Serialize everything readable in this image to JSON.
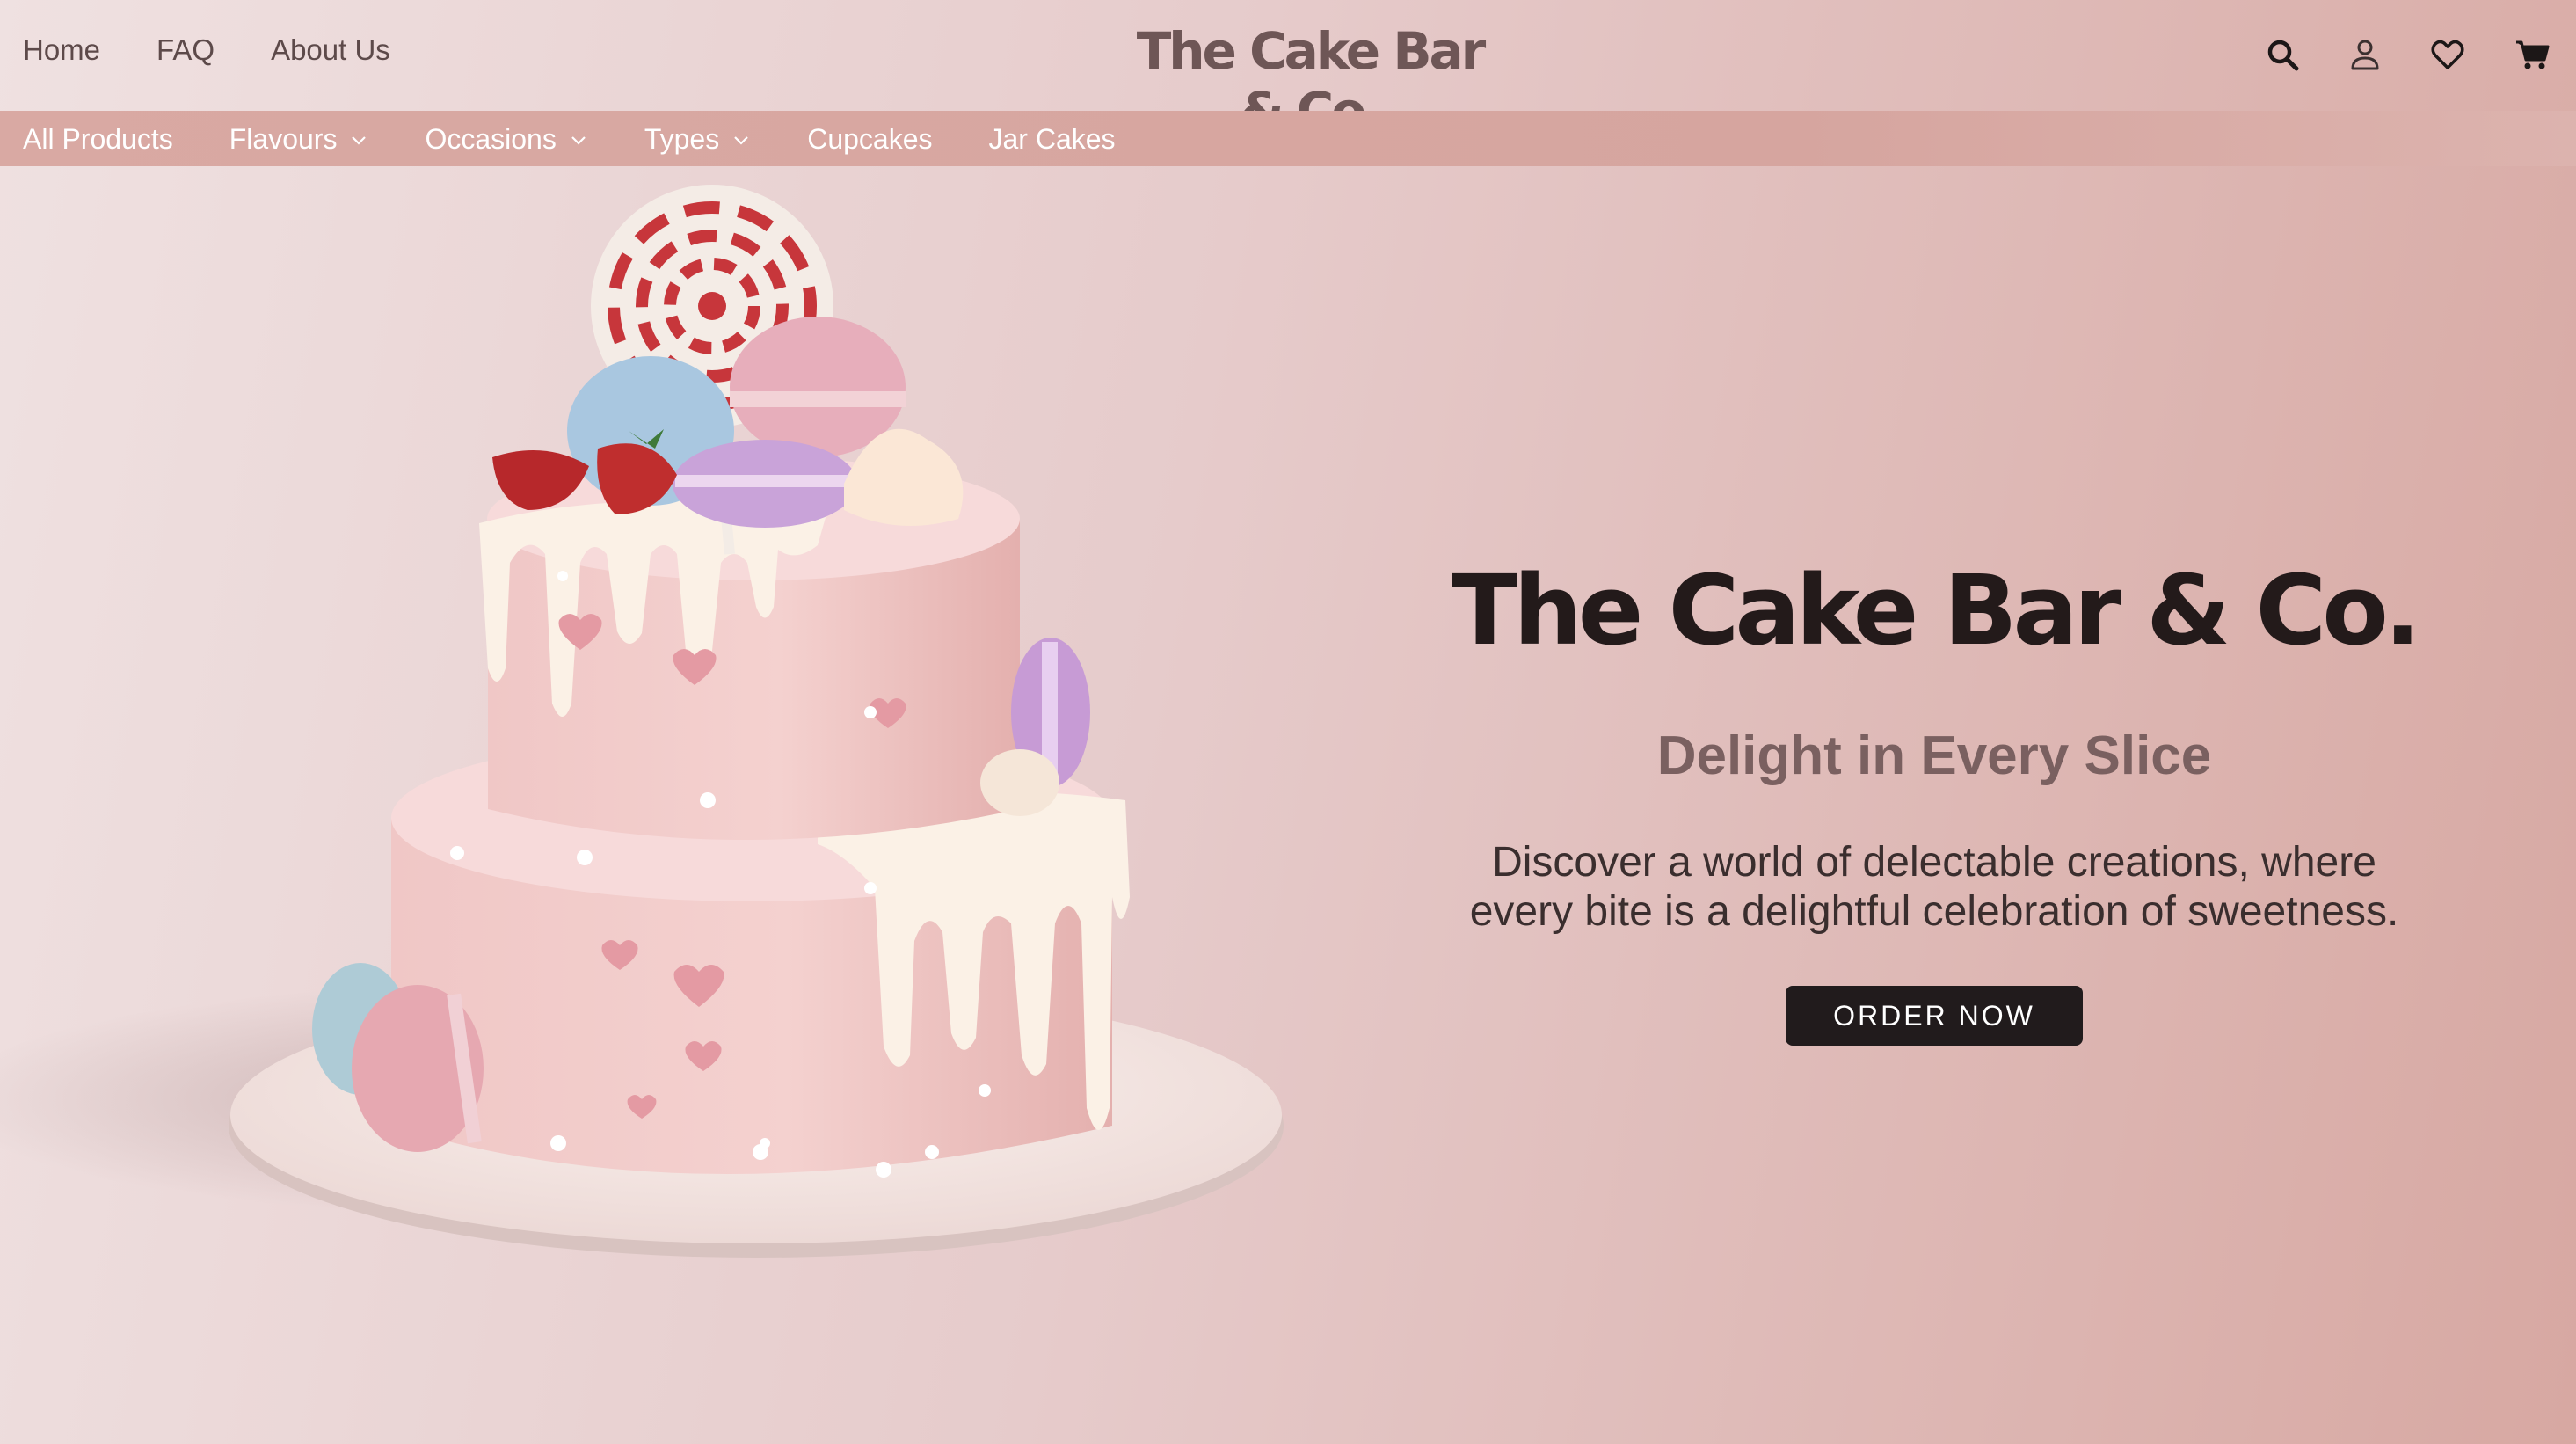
{
  "brand": "The Cake Bar & Co.",
  "top_nav": [
    "Home",
    "FAQ",
    "About Us"
  ],
  "header_icons": [
    "search-icon",
    "user-icon",
    "heart-icon",
    "cart-icon"
  ],
  "categories": [
    {
      "label": "All Products",
      "dropdown": false
    },
    {
      "label": "Flavours",
      "dropdown": true
    },
    {
      "label": "Occasions",
      "dropdown": true
    },
    {
      "label": "Types",
      "dropdown": true
    },
    {
      "label": "Cupcakes",
      "dropdown": false
    },
    {
      "label": "Jar Cakes",
      "dropdown": false
    }
  ],
  "hero": {
    "title": "The Cake Bar & Co.",
    "subtitle": "Delight in Every Slice",
    "description": "Discover a world of delectable creations, where every bite is a delightful celebration of sweetness.",
    "cta": "ORDER NOW"
  },
  "colors": {
    "background": "#e6cbcb",
    "category_bar": "#d6a59f",
    "button": "#211b1c",
    "brand_text": "#6e5656"
  }
}
